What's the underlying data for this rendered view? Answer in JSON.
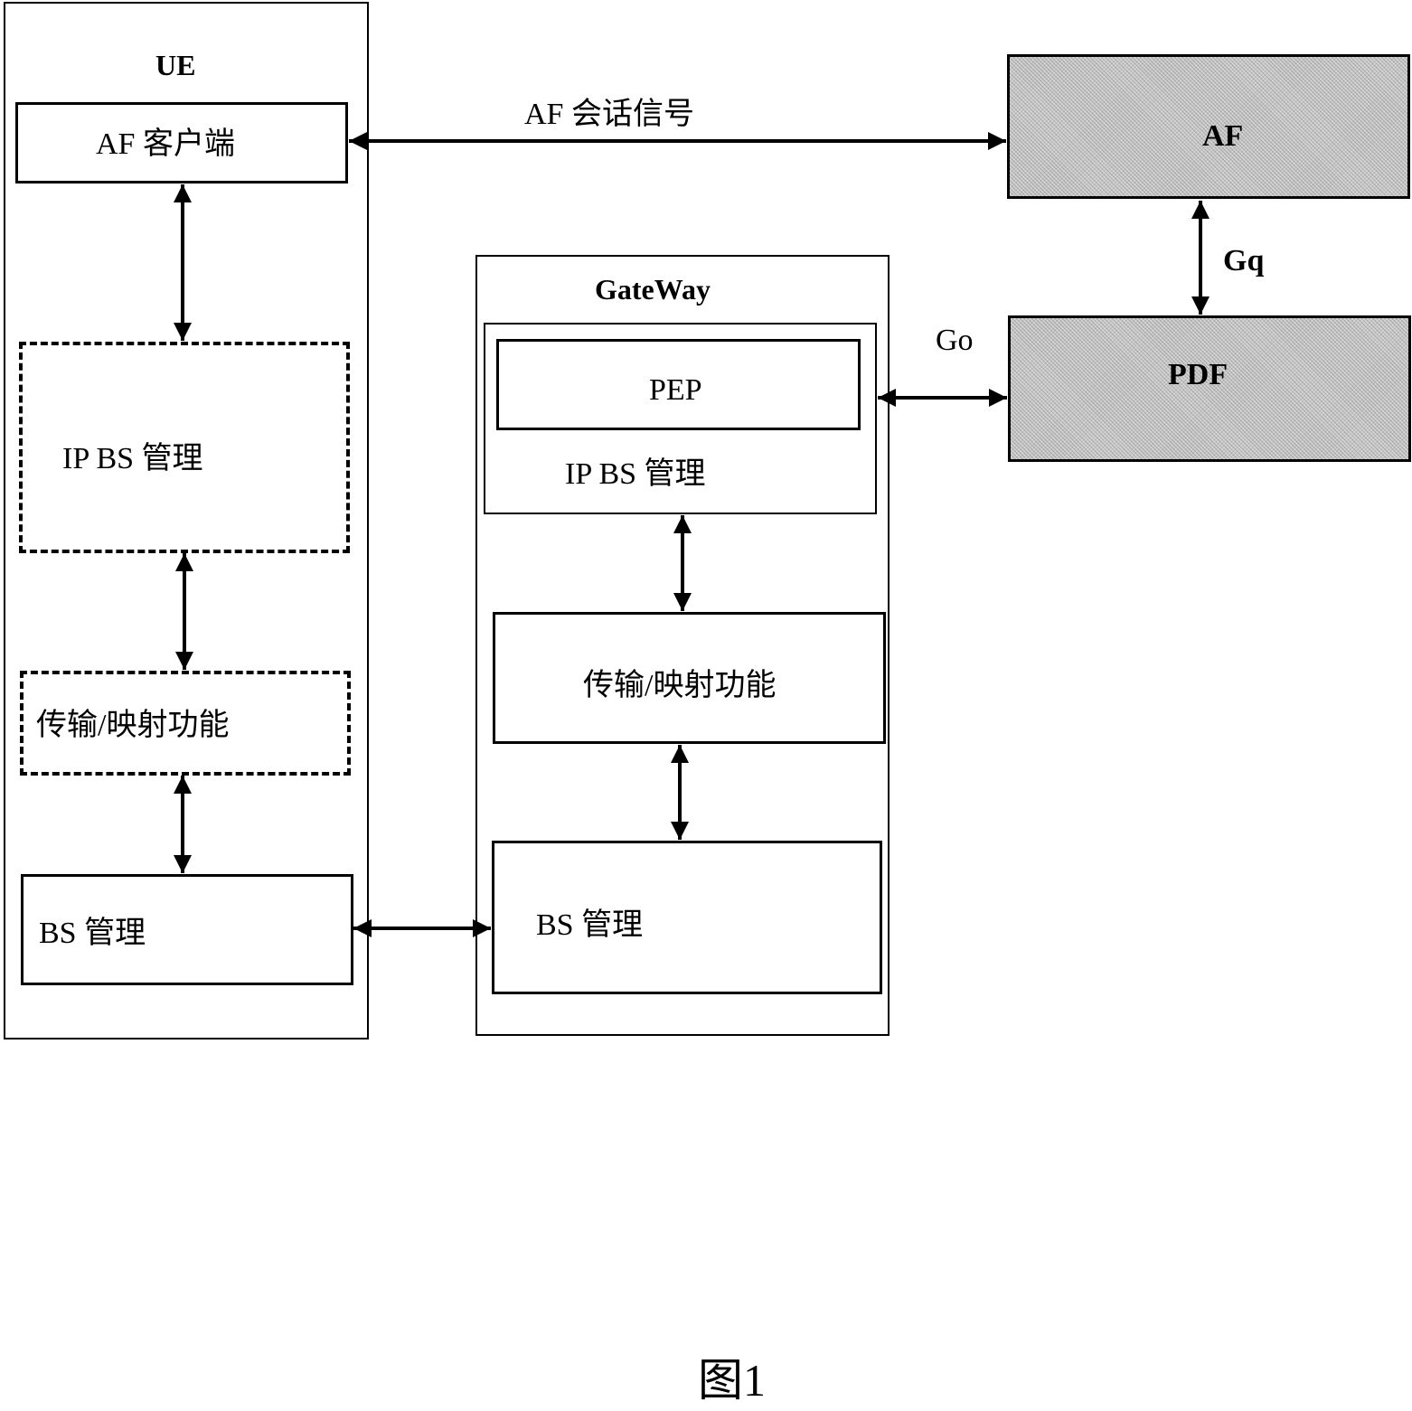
{
  "ue": {
    "title": "UE",
    "af_client": "AF 客户端",
    "ip_bs_mgmt": "IP BS 管理",
    "transport_mapping": "传输/映射功能",
    "bs_mgmt": "BS 管理"
  },
  "gateway": {
    "title": "GateWay",
    "pep": "PEP",
    "ip_bs_mgmt": "IP BS 管理",
    "transport_mapping": "传输/映射功能",
    "bs_mgmt": "BS 管理"
  },
  "af": {
    "title": "AF"
  },
  "pdf": {
    "title": "PDF"
  },
  "links": {
    "af_session_signal": "AF 会话信号",
    "gq": "Gq",
    "go": "Go"
  },
  "caption": "图1"
}
